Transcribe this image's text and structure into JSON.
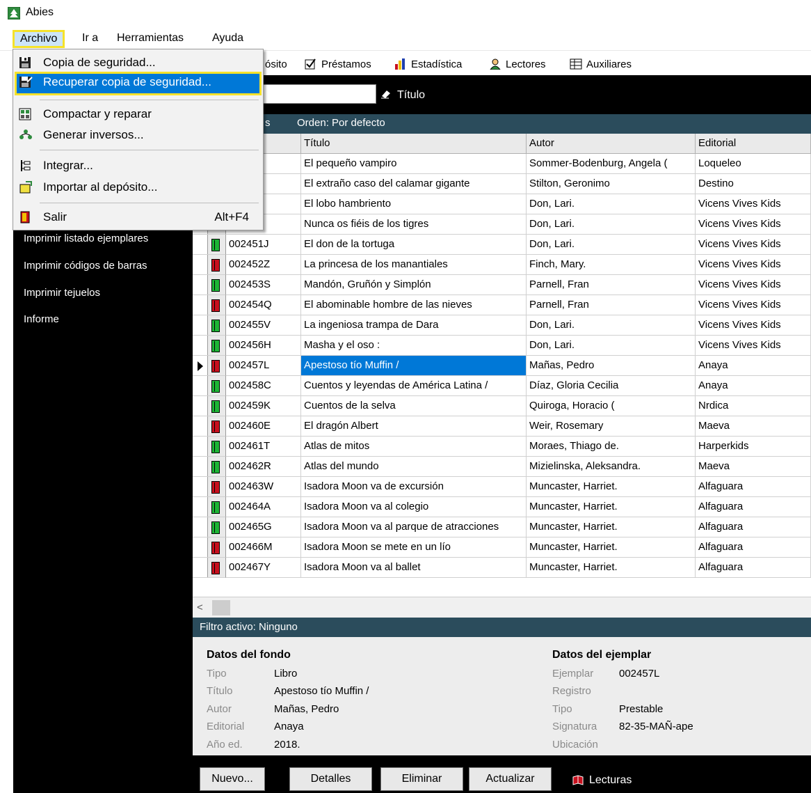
{
  "window": {
    "title": "Abies"
  },
  "menubar": {
    "items": [
      "Archivo",
      "Ir a",
      "Herramientas",
      "Ayuda"
    ]
  },
  "toolbar": {
    "items": [
      "ósito",
      "Préstamos",
      "Estadística",
      "Lectores",
      "Auxiliares"
    ]
  },
  "archivo_menu": {
    "backup": "Copia de seguridad...",
    "restore": "Recuperar copia de seguridad...",
    "compact": "Compactar y reparar",
    "inverse": "Generar inversos...",
    "integrate": "Integrar...",
    "import": "Importar al depósito...",
    "exit": "Salir",
    "exit_shortcut": "Alt+F4"
  },
  "leftnav": {
    "items": [
      "Imprimir listado ejemplares",
      "Imprimir códigos de barras",
      "Imprimir tejuelos",
      "Informe"
    ]
  },
  "search": {
    "field_label": "Título"
  },
  "grid": {
    "strip_left": "s",
    "order": "Orden: Por defecto",
    "columns": [
      "ar",
      "Título",
      "Autor",
      "Editorial"
    ],
    "rows": [
      {
        "id": "7D",
        "title": "El pequeño vampiro",
        "author": "Sommer-Bodenburg, Angela (",
        "publisher": "Loqueleo",
        "icon": "none"
      },
      {
        "id": "8X",
        "title": "El extraño caso del calamar gigante",
        "author": "Stilton, Geronimo",
        "publisher": "Destino",
        "icon": "none"
      },
      {
        "id": "9B",
        "title": "El lobo hambriento",
        "author": "Don, Lari.",
        "publisher": "Vicens Vives Kids",
        "icon": "none"
      },
      {
        "id": "0N",
        "title": "Nunca os fiéis de los tigres",
        "author": "Don, Lari.",
        "publisher": "Vicens Vives Kids",
        "icon": "none"
      },
      {
        "id": "002451J",
        "title": "El don de la tortuga",
        "author": "Don, Lari.",
        "publisher": "Vicens Vives Kids",
        "icon": "green"
      },
      {
        "id": "002452Z",
        "title": "La princesa de los manantiales",
        "author": "Finch, Mary.",
        "publisher": "Vicens Vives Kids",
        "icon": "red"
      },
      {
        "id": "002453S",
        "title": "Mandón, Gruñón y Simplón",
        "author": "Parnell, Fran",
        "publisher": "Vicens Vives Kids",
        "icon": "green"
      },
      {
        "id": "002454Q",
        "title": "El abominable hombre de las nieves",
        "author": "Parnell, Fran",
        "publisher": "Vicens Vives Kids",
        "icon": "red"
      },
      {
        "id": "002455V",
        "title": "La ingeniosa trampa de Dara",
        "author": "Don, Lari.",
        "publisher": "Vicens Vives Kids",
        "icon": "green"
      },
      {
        "id": "002456H",
        "title": "Masha y el oso :",
        "author": "Don, Lari.",
        "publisher": "Vicens Vives Kids",
        "icon": "green"
      },
      {
        "id": "002457L",
        "title": "Apestoso tío Muffin /",
        "author": "Mañas, Pedro",
        "publisher": "Anaya",
        "icon": "red"
      },
      {
        "id": "002458C",
        "title": "Cuentos y leyendas de América Latina /",
        "author": "Díaz, Gloria Cecilia",
        "publisher": "Anaya",
        "icon": "green"
      },
      {
        "id": "002459K",
        "title": "Cuentos de la selva",
        "author": "Quiroga, Horacio (",
        "publisher": "Nrdica",
        "icon": "green"
      },
      {
        "id": "002460E",
        "title": "El dragón Albert",
        "author": "Weir, Rosemary",
        "publisher": "Maeva",
        "icon": "red"
      },
      {
        "id": "002461T",
        "title": "Atlas de mitos",
        "author": "Moraes, Thiago de.",
        "publisher": "Harperkids",
        "icon": "green"
      },
      {
        "id": "002462R",
        "title": "Atlas del mundo",
        "author": "Mizielinska, Aleksandra.",
        "publisher": "Maeva",
        "icon": "green"
      },
      {
        "id": "002463W",
        "title": "Isadora Moon va de excursión",
        "author": "Muncaster, Harriet.",
        "publisher": "Alfaguara",
        "icon": "red"
      },
      {
        "id": "002464A",
        "title": "Isadora Moon va al colegio",
        "author": "Muncaster, Harriet.",
        "publisher": "Alfaguara",
        "icon": "green"
      },
      {
        "id": "002465G",
        "title": "Isadora Moon va al parque de atracciones",
        "author": "Muncaster, Harriet.",
        "publisher": "Alfaguara",
        "icon": "green"
      },
      {
        "id": "002466M",
        "title": "Isadora Moon se mete en un lío",
        "author": "Muncaster, Harriet.",
        "publisher": "Alfaguara",
        "icon": "red"
      },
      {
        "id": "002467Y",
        "title": "Isadora Moon va al ballet",
        "author": "Muncaster, Harriet.",
        "publisher": "Alfaguara",
        "icon": "red"
      }
    ]
  },
  "filter": {
    "text": "Filtro activo: Ninguno"
  },
  "fondo": {
    "heading": "Datos del fondo",
    "labels": [
      "Tipo",
      "Título",
      "Autor",
      "Editorial",
      "Año ed."
    ],
    "values": [
      "Libro",
      "Apestoso tío Muffin /",
      "Mañas, Pedro",
      "Anaya",
      "2018."
    ]
  },
  "ejemplar": {
    "heading": "Datos del ejemplar",
    "labels": [
      "Ejemplar",
      "Registro",
      "Tipo",
      "Signatura",
      "Ubicación"
    ],
    "values": [
      "002457L",
      "",
      "Prestable",
      "82-35-MAÑ-ape",
      ""
    ]
  },
  "buttons": {
    "new": "Nuevo...",
    "details": "Detalles",
    "delete": "Eliminar",
    "refresh": "Actualizar",
    "readings": "Lecturas"
  },
  "colors": {
    "accent": "#0078d7",
    "highlight_box": "#f5e22a",
    "header_strip": "#2b4c5c",
    "loan_available": "#1db536",
    "loan_out": "#c8101e"
  }
}
